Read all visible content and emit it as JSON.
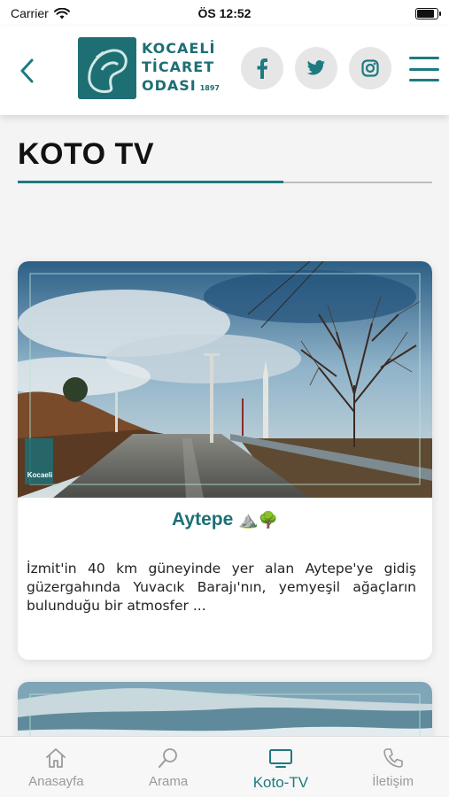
{
  "status_bar": {
    "carrier": "Carrier",
    "time": "ÖS 12:52",
    "battery_level": 0.9
  },
  "header": {
    "logo_lines": [
      "KOCAELİ",
      "TİCARET",
      "ODASI"
    ],
    "logo_year": "1897",
    "social": [
      "facebook-icon",
      "twitter-icon",
      "instagram-icon"
    ]
  },
  "page": {
    "title": "KOTO TV"
  },
  "videos": [
    {
      "title": "Aytepe",
      "title_emoji": "⛰️🌳",
      "image_watermark": "Kocaeli",
      "description": "İzmit'in 40 km güneyinde yer alan Aytepe'ye gidiş güzergahında Yuvacık Barajı'nın, yemyeşil ağaçların bulunduğu bir atmosfer ..."
    }
  ],
  "tabbar": {
    "items": [
      {
        "label": "Anasayfa",
        "icon": "home-icon"
      },
      {
        "label": "Arama",
        "icon": "search-icon"
      },
      {
        "label": "Koto-TV",
        "icon": "tv-icon",
        "active": true
      },
      {
        "label": "İletişim",
        "icon": "phone-icon"
      }
    ]
  },
  "colors": {
    "accent": "#1d7a80",
    "logo": "#1d6f74",
    "inactive": "#9a9a9a"
  }
}
